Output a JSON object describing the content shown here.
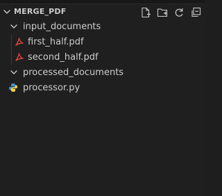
{
  "explorer": {
    "section_title": "MERGE_PDF",
    "actions": [
      {
        "name": "new-file-icon"
      },
      {
        "name": "new-folder-icon"
      },
      {
        "name": "refresh-icon"
      },
      {
        "name": "collapse-all-icon"
      }
    ]
  },
  "tree": {
    "folder1": {
      "label": "input_documents",
      "expanded": true
    },
    "file1": {
      "label": "first_half.pdf",
      "icon": "pdf-icon"
    },
    "file2": {
      "label": "second_half.pdf",
      "icon": "pdf-icon"
    },
    "folder2": {
      "label": "processed_documents",
      "expanded": true
    },
    "file3": {
      "label": "processor.py",
      "icon": "python-icon"
    }
  },
  "colors": {
    "background": "#1f1f1f",
    "text": "#cccccc",
    "pdf_icon": "#d9463b",
    "python_icon_blue": "#4b8bbe",
    "python_icon_yellow": "#ffd43b"
  }
}
